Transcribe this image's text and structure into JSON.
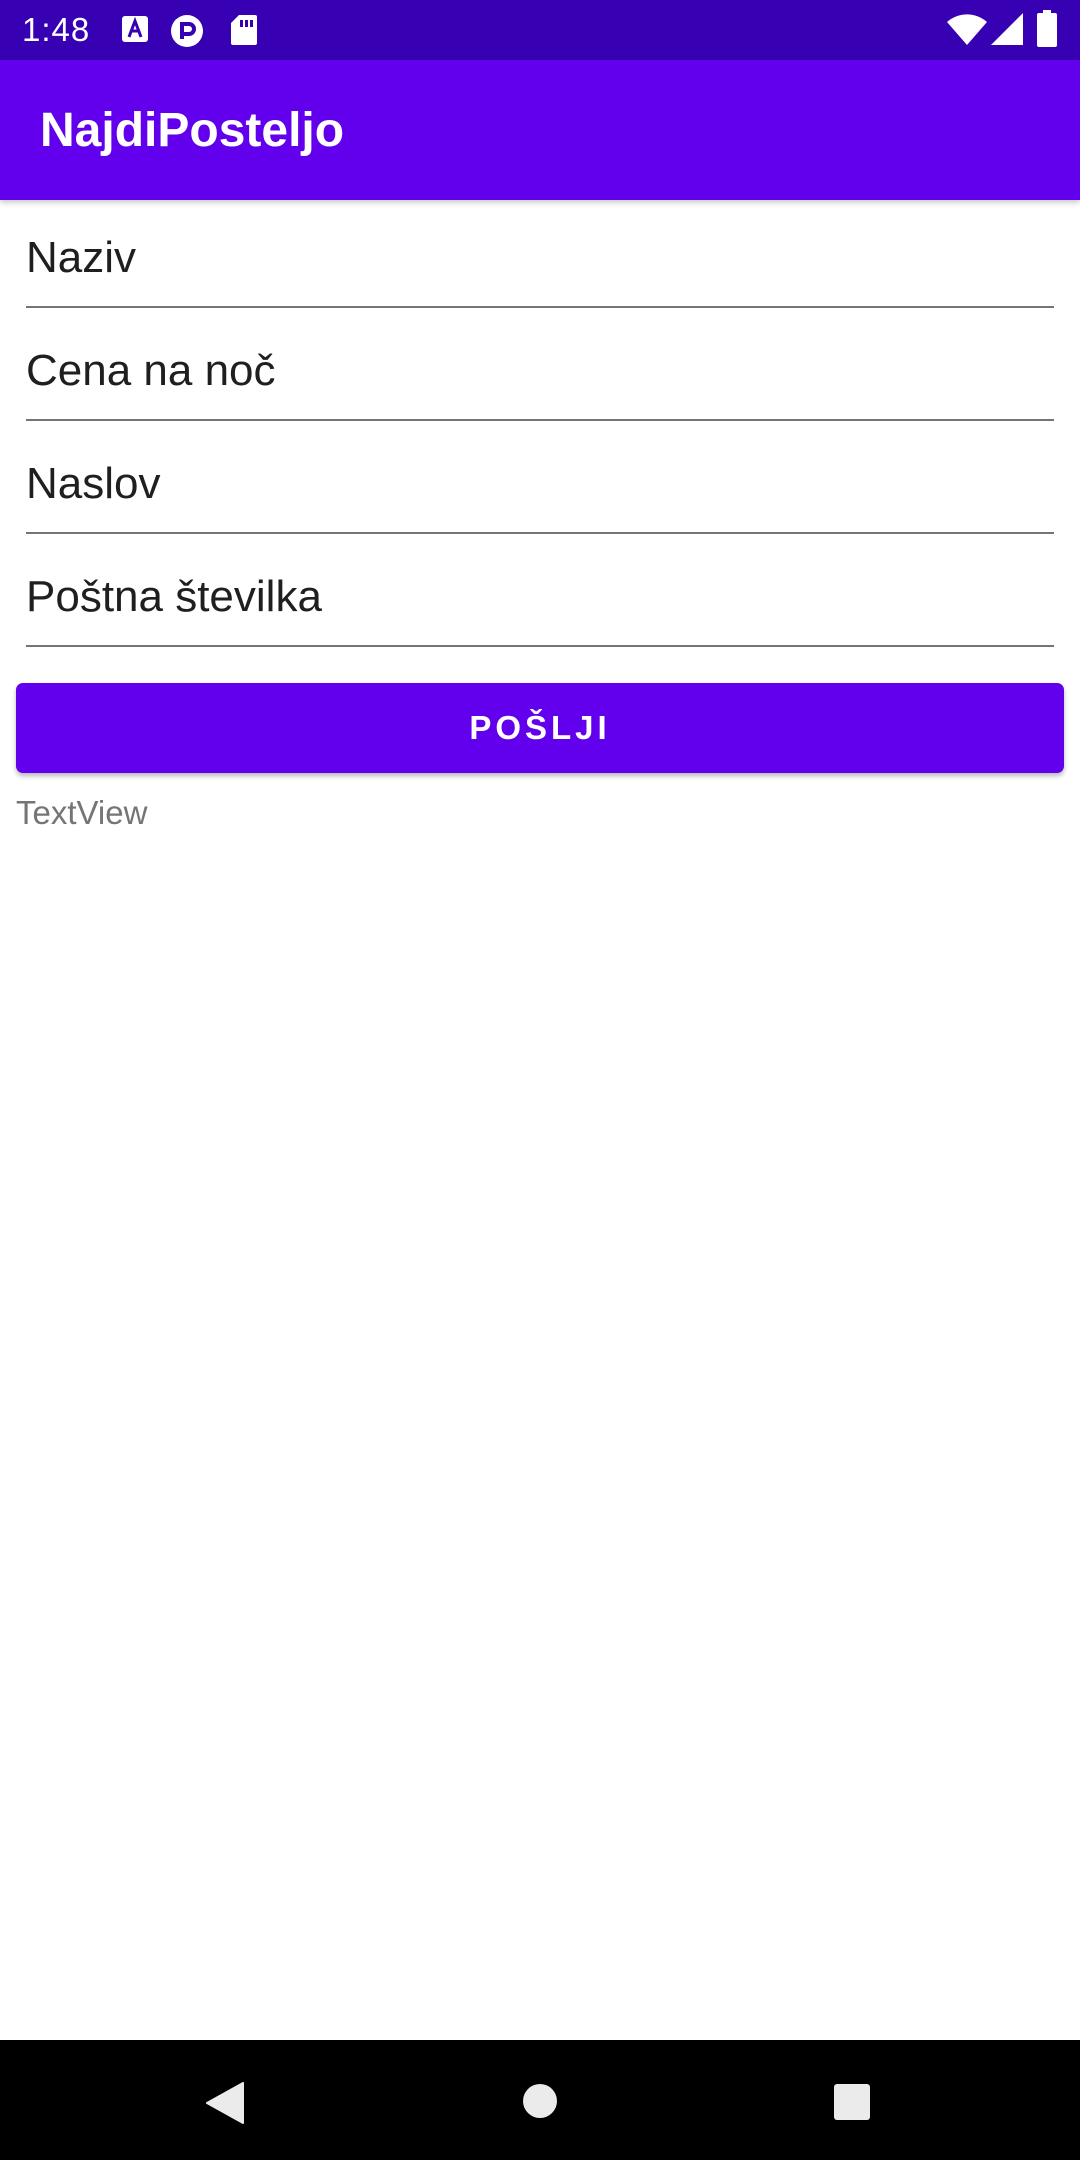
{
  "status_bar": {
    "time": "1:48",
    "notification_icons": [
      "a-accessibility-icon",
      "pocket-casts-icon",
      "sd-card-icon"
    ],
    "system_icons": [
      "wifi-icon",
      "cell-signal-icon",
      "battery-icon"
    ]
  },
  "app_bar": {
    "title": "NajdiPosteljo"
  },
  "form": {
    "fields": [
      {
        "placeholder": "Naziv",
        "value": ""
      },
      {
        "placeholder": "Cena na noč",
        "value": ""
      },
      {
        "placeholder": "Naslov",
        "value": ""
      },
      {
        "placeholder": "Poštna številka",
        "value": ""
      }
    ],
    "submit_label": "POŠLJI",
    "output_text": "TextView"
  },
  "nav_bar": {
    "buttons": [
      "back-icon",
      "home-icon",
      "recents-icon"
    ]
  },
  "colors": {
    "primary": "#6200ee",
    "primary_dark": "#3700b3",
    "nav_background": "#000000"
  }
}
